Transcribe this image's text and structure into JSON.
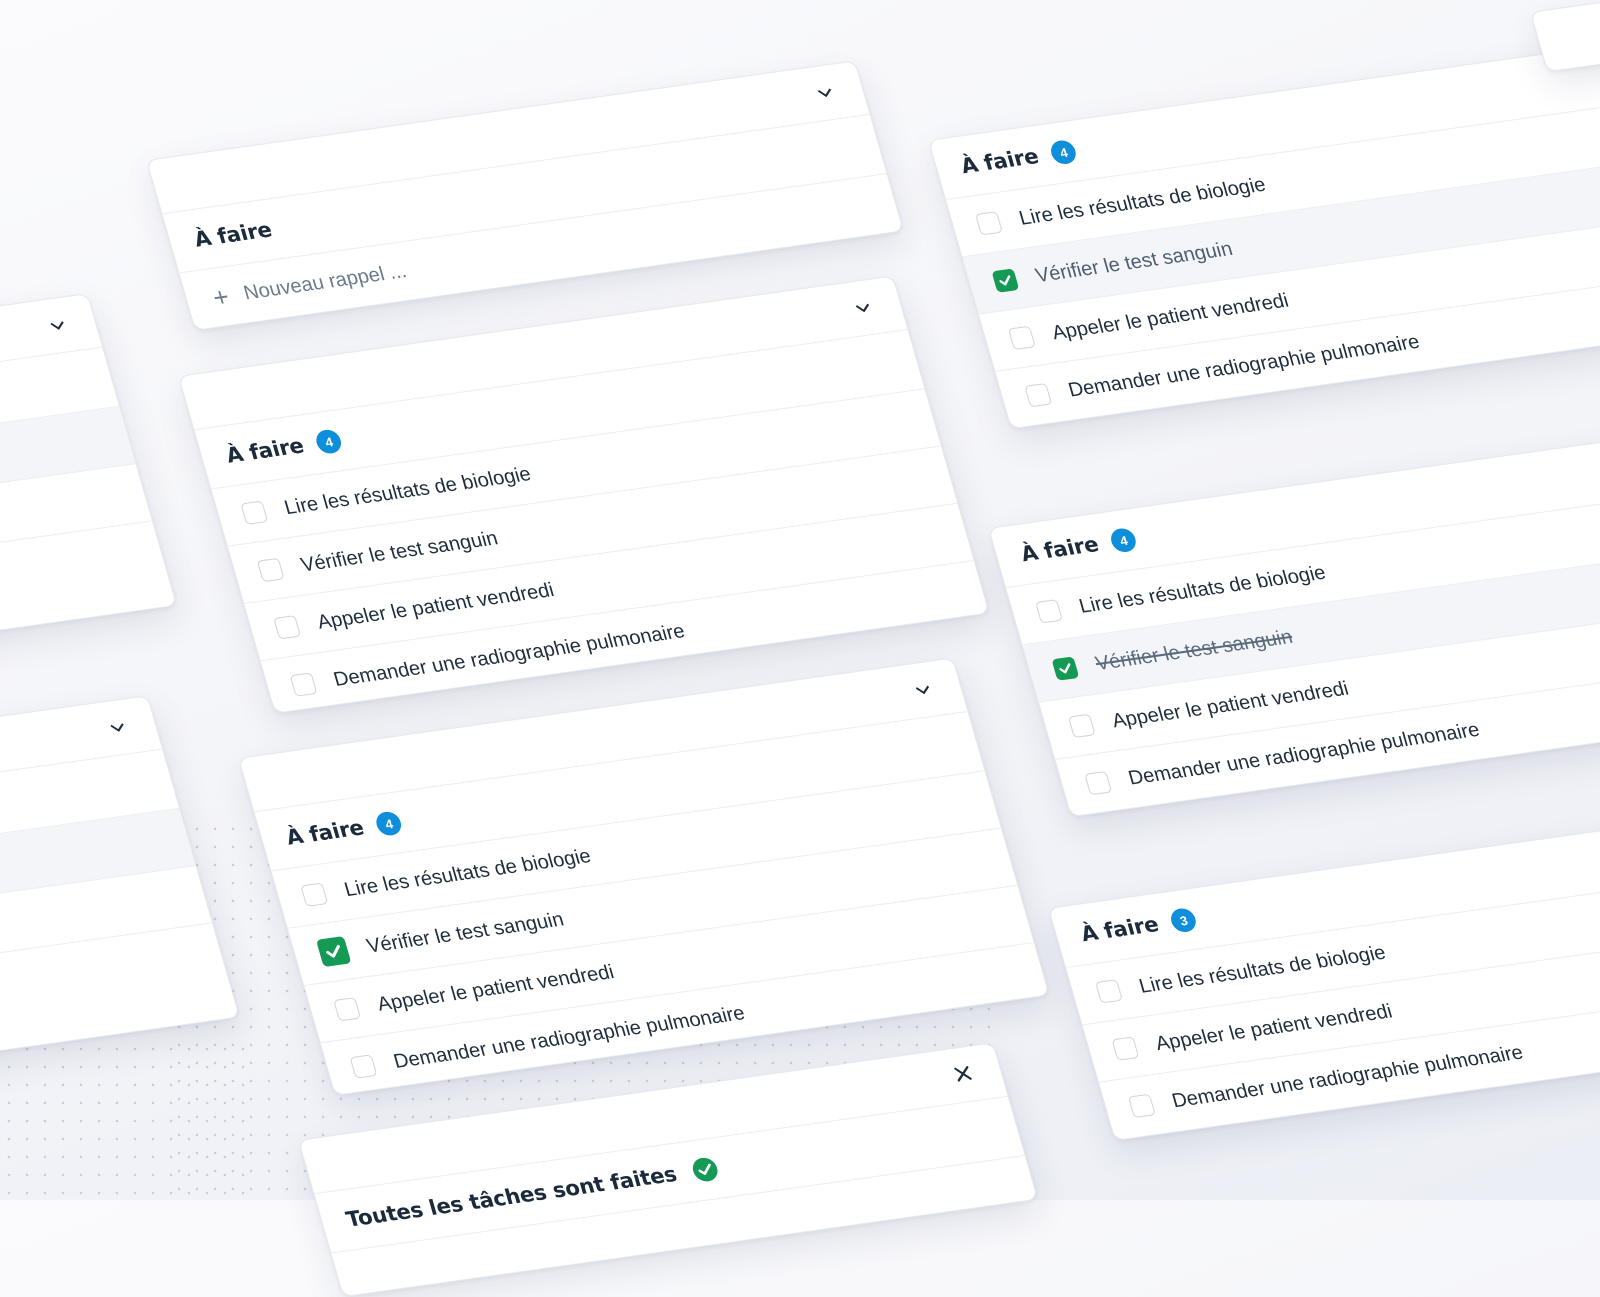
{
  "colors": {
    "accent": "#0f8fdb",
    "success": "#159a55",
    "text": "#1c2b3c",
    "muted": "#6c7a8c"
  },
  "simple_card": {
    "title": "À faire",
    "new_reminder_placeholder": "Nouveau rappel ...",
    "icon": "chevron-down-icon"
  },
  "card_plain": {
    "title": "À faire",
    "count": "4",
    "tasks": [
      "Lire les résultats de biologie",
      "Vérifier le test sanguin",
      "Appeler le patient vendredi",
      "Demander une radiographie pulmonaire"
    ]
  },
  "card_checked": {
    "title": "À faire",
    "count": "4",
    "tasks": [
      "Lire les résultats de biologie",
      "Vérifier le test sanguin",
      "Appeler le patient vendredi",
      "Demander une radiographie pulmonaire"
    ],
    "checked_index": 1
  },
  "card_hover_checked": {
    "title": "À faire",
    "count": "4",
    "tasks": [
      "Lire les résultats de biologie",
      "Vérifier le test sanguin",
      "Appeler le patient vendredi",
      "Demander une radiographie pulmonaire"
    ],
    "checked_index": 1
  },
  "card_strike": {
    "title": "À faire",
    "count": "4",
    "tasks": [
      "Lire les résultats de biologie",
      "Vérifier le test sanguin",
      "Appeler le patient vendredi",
      "Demander une radiographie pulmonaire"
    ],
    "checked_index": 1
  },
  "card_three": {
    "title": "À faire",
    "count": "3",
    "tasks": [
      "Lire les résultats de biologie",
      "Appeler le patient vendredi",
      "Demander une radiographie pulmonaire"
    ]
  },
  "done_card": {
    "title": "Toutes les tâches sont faites",
    "icon": "check-circle-icon",
    "close_icon": "close-icon"
  }
}
